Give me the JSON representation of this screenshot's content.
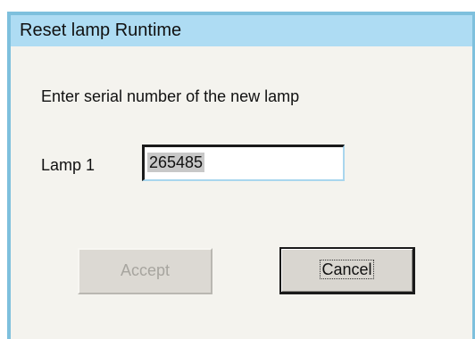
{
  "dialog": {
    "title": "Reset lamp Runtime",
    "instruction": "Enter serial number of the new lamp",
    "lamp_label": "Lamp 1",
    "serial_value": "265485",
    "accept_label": "Accept",
    "cancel_label": "Cancel",
    "accept_enabled": false,
    "focused_button": "Cancel"
  },
  "colors": {
    "title_bar": "#aedcf3",
    "frame": "#7ec0dd",
    "background": "#f4f3ee",
    "disabled_text": "#a7a59f"
  }
}
